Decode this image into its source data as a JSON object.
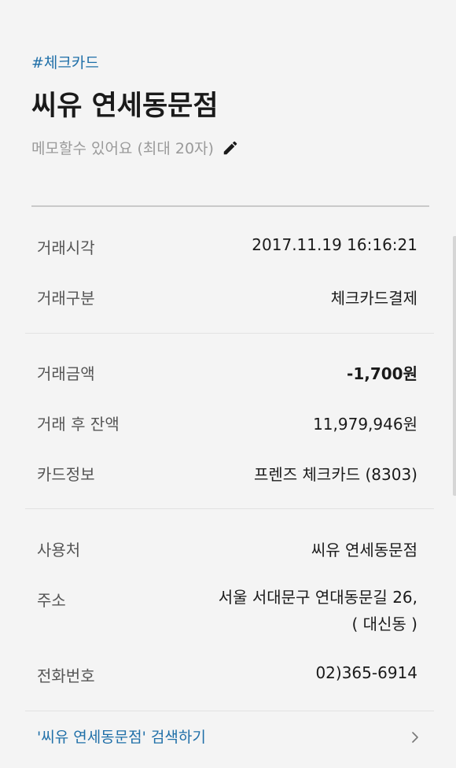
{
  "header": {
    "hashtag": "#체크카드",
    "title": "씨유 연세동문점",
    "memo_placeholder": "메모할수 있어요 (최대 20자)"
  },
  "transaction": {
    "time": {
      "label": "거래시각",
      "value": "2017.11.19 16:16:21"
    },
    "type": {
      "label": "거래구분",
      "value": "체크카드결제"
    },
    "amount": {
      "label": "거래금액",
      "value": "-1,700원"
    },
    "balance": {
      "label": "거래 후 잔액",
      "value": "11,979,946원"
    },
    "card": {
      "label": "카드정보",
      "value": "프렌즈 체크카드 (8303)"
    }
  },
  "merchant": {
    "name": {
      "label": "사용처",
      "value": "씨유 연세동문점"
    },
    "address": {
      "label": "주소",
      "line1": "서울 서대문구 연대동문길 26,",
      "line2": "( 대신동 )"
    },
    "phone": {
      "label": "전화번호",
      "value": "02)365-6914"
    }
  },
  "search": {
    "label": "'씨유 연세동문점' 검색하기"
  },
  "icons": {
    "edit": "pencil-icon",
    "more": "chevron-right-icon"
  },
  "colors": {
    "accent": "#1f6fa8",
    "background": "#f4f4f4",
    "muted": "#9a9a9a"
  }
}
